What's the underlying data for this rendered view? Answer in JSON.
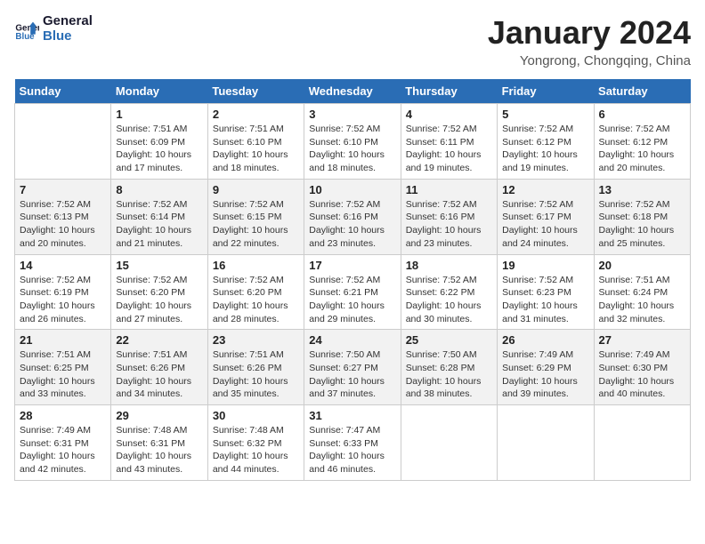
{
  "header": {
    "logo_line1": "General",
    "logo_line2": "Blue",
    "month_title": "January 2024",
    "subtitle": "Yongrong, Chongqing, China"
  },
  "columns": [
    "Sunday",
    "Monday",
    "Tuesday",
    "Wednesday",
    "Thursday",
    "Friday",
    "Saturday"
  ],
  "weeks": [
    [
      {
        "day": "",
        "info": ""
      },
      {
        "day": "1",
        "info": "Sunrise: 7:51 AM\nSunset: 6:09 PM\nDaylight: 10 hours\nand 17 minutes."
      },
      {
        "day": "2",
        "info": "Sunrise: 7:51 AM\nSunset: 6:10 PM\nDaylight: 10 hours\nand 18 minutes."
      },
      {
        "day": "3",
        "info": "Sunrise: 7:52 AM\nSunset: 6:10 PM\nDaylight: 10 hours\nand 18 minutes."
      },
      {
        "day": "4",
        "info": "Sunrise: 7:52 AM\nSunset: 6:11 PM\nDaylight: 10 hours\nand 19 minutes."
      },
      {
        "day": "5",
        "info": "Sunrise: 7:52 AM\nSunset: 6:12 PM\nDaylight: 10 hours\nand 19 minutes."
      },
      {
        "day": "6",
        "info": "Sunrise: 7:52 AM\nSunset: 6:12 PM\nDaylight: 10 hours\nand 20 minutes."
      }
    ],
    [
      {
        "day": "7",
        "info": "Sunrise: 7:52 AM\nSunset: 6:13 PM\nDaylight: 10 hours\nand 20 minutes."
      },
      {
        "day": "8",
        "info": "Sunrise: 7:52 AM\nSunset: 6:14 PM\nDaylight: 10 hours\nand 21 minutes."
      },
      {
        "day": "9",
        "info": "Sunrise: 7:52 AM\nSunset: 6:15 PM\nDaylight: 10 hours\nand 22 minutes."
      },
      {
        "day": "10",
        "info": "Sunrise: 7:52 AM\nSunset: 6:16 PM\nDaylight: 10 hours\nand 23 minutes."
      },
      {
        "day": "11",
        "info": "Sunrise: 7:52 AM\nSunset: 6:16 PM\nDaylight: 10 hours\nand 23 minutes."
      },
      {
        "day": "12",
        "info": "Sunrise: 7:52 AM\nSunset: 6:17 PM\nDaylight: 10 hours\nand 24 minutes."
      },
      {
        "day": "13",
        "info": "Sunrise: 7:52 AM\nSunset: 6:18 PM\nDaylight: 10 hours\nand 25 minutes."
      }
    ],
    [
      {
        "day": "14",
        "info": "Sunrise: 7:52 AM\nSunset: 6:19 PM\nDaylight: 10 hours\nand 26 minutes."
      },
      {
        "day": "15",
        "info": "Sunrise: 7:52 AM\nSunset: 6:20 PM\nDaylight: 10 hours\nand 27 minutes."
      },
      {
        "day": "16",
        "info": "Sunrise: 7:52 AM\nSunset: 6:20 PM\nDaylight: 10 hours\nand 28 minutes."
      },
      {
        "day": "17",
        "info": "Sunrise: 7:52 AM\nSunset: 6:21 PM\nDaylight: 10 hours\nand 29 minutes."
      },
      {
        "day": "18",
        "info": "Sunrise: 7:52 AM\nSunset: 6:22 PM\nDaylight: 10 hours\nand 30 minutes."
      },
      {
        "day": "19",
        "info": "Sunrise: 7:52 AM\nSunset: 6:23 PM\nDaylight: 10 hours\nand 31 minutes."
      },
      {
        "day": "20",
        "info": "Sunrise: 7:51 AM\nSunset: 6:24 PM\nDaylight: 10 hours\nand 32 minutes."
      }
    ],
    [
      {
        "day": "21",
        "info": "Sunrise: 7:51 AM\nSunset: 6:25 PM\nDaylight: 10 hours\nand 33 minutes."
      },
      {
        "day": "22",
        "info": "Sunrise: 7:51 AM\nSunset: 6:26 PM\nDaylight: 10 hours\nand 34 minutes."
      },
      {
        "day": "23",
        "info": "Sunrise: 7:51 AM\nSunset: 6:26 PM\nDaylight: 10 hours\nand 35 minutes."
      },
      {
        "day": "24",
        "info": "Sunrise: 7:50 AM\nSunset: 6:27 PM\nDaylight: 10 hours\nand 37 minutes."
      },
      {
        "day": "25",
        "info": "Sunrise: 7:50 AM\nSunset: 6:28 PM\nDaylight: 10 hours\nand 38 minutes."
      },
      {
        "day": "26",
        "info": "Sunrise: 7:49 AM\nSunset: 6:29 PM\nDaylight: 10 hours\nand 39 minutes."
      },
      {
        "day": "27",
        "info": "Sunrise: 7:49 AM\nSunset: 6:30 PM\nDaylight: 10 hours\nand 40 minutes."
      }
    ],
    [
      {
        "day": "28",
        "info": "Sunrise: 7:49 AM\nSunset: 6:31 PM\nDaylight: 10 hours\nand 42 minutes."
      },
      {
        "day": "29",
        "info": "Sunrise: 7:48 AM\nSunset: 6:31 PM\nDaylight: 10 hours\nand 43 minutes."
      },
      {
        "day": "30",
        "info": "Sunrise: 7:48 AM\nSunset: 6:32 PM\nDaylight: 10 hours\nand 44 minutes."
      },
      {
        "day": "31",
        "info": "Sunrise: 7:47 AM\nSunset: 6:33 PM\nDaylight: 10 hours\nand 46 minutes."
      },
      {
        "day": "",
        "info": ""
      },
      {
        "day": "",
        "info": ""
      },
      {
        "day": "",
        "info": ""
      }
    ]
  ]
}
